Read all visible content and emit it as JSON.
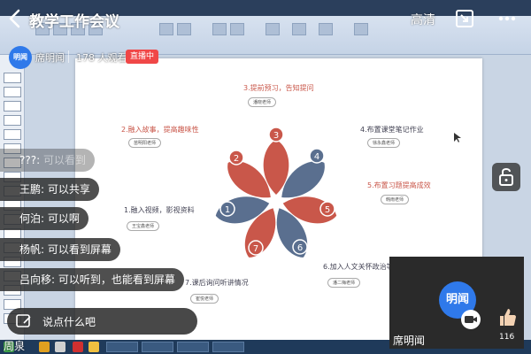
{
  "header": {
    "title": "教学工作会议",
    "quality": "高清"
  },
  "info": {
    "logo_text": "明闻",
    "host": "席明闻",
    "viewers": "178 人观看",
    "live": "直播中"
  },
  "slide": {
    "items": [
      {
        "num": "1",
        "title": "1.融入视频，影视资料",
        "teacher": "王宝鑫老师"
      },
      {
        "num": "2",
        "title": "2.融入故事，提高趣味性",
        "teacher": "苗明阳老师"
      },
      {
        "num": "3",
        "title": "3.提前预习，告知提问",
        "teacher": "潘晓老师"
      },
      {
        "num": "4",
        "title": "4.布置课堂笔记作业",
        "teacher": "徐永鑫老师"
      },
      {
        "num": "5",
        "title": "5.布置习题提高成效",
        "teacher": "韩雨老师"
      },
      {
        "num": "6",
        "title": "6.加入人文关怀政治等",
        "teacher": "潘二梅老师"
      },
      {
        "num": "7",
        "title": "7.课后询问听讲情况",
        "teacher": "崔悦老师"
      }
    ]
  },
  "chat": {
    "messages": [
      {
        "name": "???:",
        "text": "可以看到"
      },
      {
        "name": "王鹏:",
        "text": "可以共享"
      },
      {
        "name": "何泊:",
        "text": "可以啊"
      },
      {
        "name": "杨帆:",
        "text": "可以看到屏幕"
      },
      {
        "name": "吕向移:",
        "text": "可以听到，也能看到屏幕"
      }
    ],
    "placeholder": "说点什么吧",
    "bottom_name": "周泉"
  },
  "tile": {
    "avatar": "明闻",
    "name": "席明闻",
    "likes": "116"
  },
  "colors": {
    "accent": "#2f79ea",
    "live": "#f04747",
    "flower_red": "#c9574a",
    "flower_blue": "#5a6f8f"
  }
}
